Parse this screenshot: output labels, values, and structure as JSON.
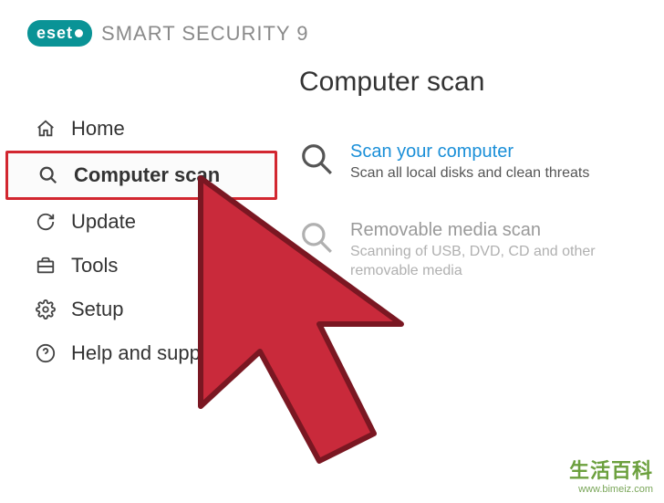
{
  "header": {
    "brand": "eset",
    "product": "SMART SECURITY 9"
  },
  "sidebar": {
    "items": [
      {
        "label": "Home",
        "icon": "home-icon",
        "highlighted": false
      },
      {
        "label": "Computer scan",
        "icon": "search-icon",
        "highlighted": true
      },
      {
        "label": "Update",
        "icon": "refresh-icon",
        "highlighted": false
      },
      {
        "label": "Tools",
        "icon": "briefcase-icon",
        "highlighted": false
      },
      {
        "label": "Setup",
        "icon": "gear-icon",
        "highlighted": false
      },
      {
        "label": "Help and support",
        "icon": "help-icon",
        "highlighted": false
      }
    ]
  },
  "main": {
    "title": "Computer scan",
    "options": [
      {
        "title": "Scan your computer",
        "desc": "Scan all local disks and clean threats",
        "faded": false
      },
      {
        "title": "Removable media scan",
        "desc": "Scanning of USB, DVD, CD and other removable media",
        "faded": true
      }
    ]
  },
  "watermark": {
    "cn": "生活百科",
    "url": "www.bimeiz.com"
  },
  "highlight_color": "#d22730",
  "accent_color": "#1a8fd8"
}
